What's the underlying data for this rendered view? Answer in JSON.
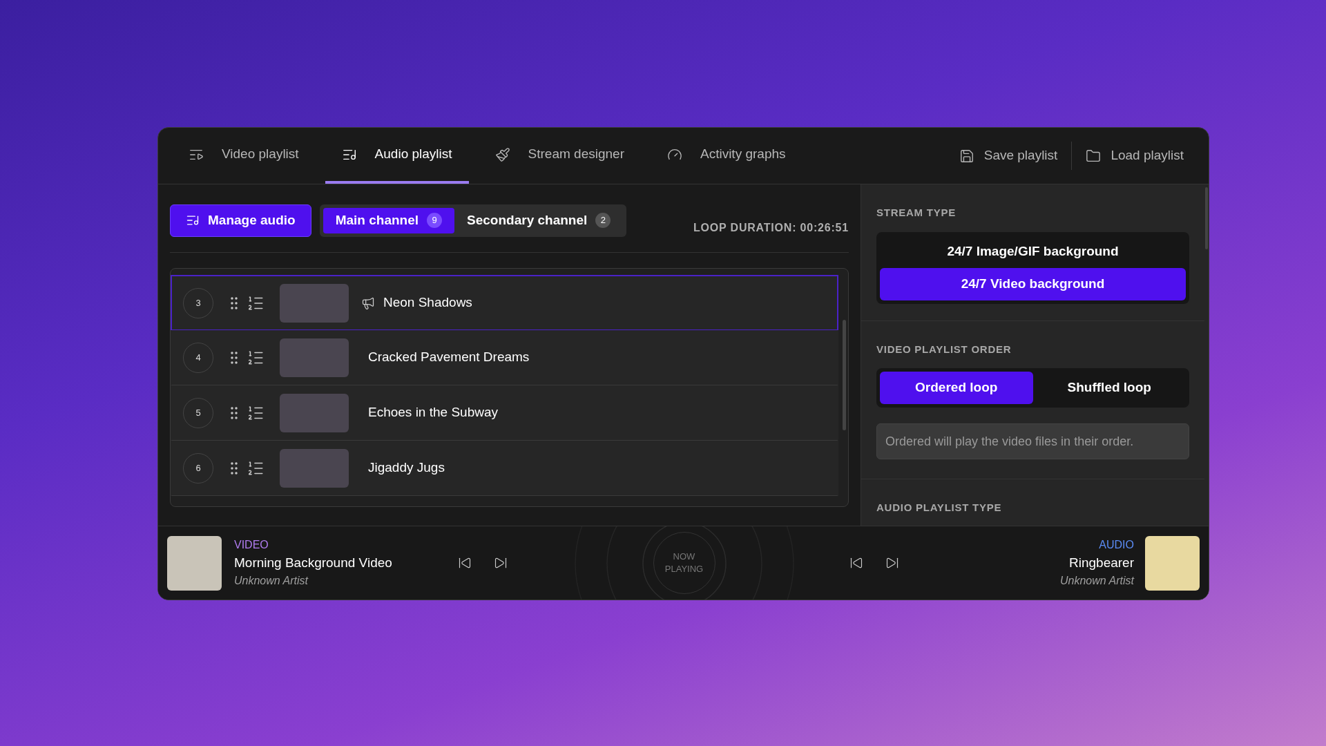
{
  "tabs": [
    {
      "label": "Video playlist",
      "selected": false
    },
    {
      "label": "Audio playlist",
      "selected": true
    },
    {
      "label": "Stream designer",
      "selected": false
    },
    {
      "label": "Activity graphs",
      "selected": false
    }
  ],
  "actions": [
    {
      "label": "Save playlist"
    },
    {
      "label": "Load playlist"
    }
  ],
  "manage_button": "Manage audio",
  "channels": [
    {
      "label": "Main channel",
      "count": "9",
      "selected": true
    },
    {
      "label": "Secondary channel",
      "count": "2",
      "selected": false
    }
  ],
  "loop_duration": "LOOP DURATION: 00:26:51",
  "tracks": [
    {
      "number": "3",
      "title": "Neon Shadows",
      "announce": true,
      "selected": true
    },
    {
      "number": "4",
      "title": "Cracked Pavement Dreams",
      "announce": false,
      "selected": false
    },
    {
      "number": "5",
      "title": "Echoes in the Subway",
      "announce": false,
      "selected": false
    },
    {
      "number": "6",
      "title": "Jigaddy Jugs",
      "announce": false,
      "selected": false
    }
  ],
  "settings": {
    "stream_type": {
      "heading": "STREAM TYPE",
      "options": [
        {
          "label": "24/7 Image/GIF background",
          "selected": false
        },
        {
          "label": "24/7 Video background",
          "selected": true
        }
      ]
    },
    "video_order": {
      "heading": "VIDEO PLAYLIST ORDER",
      "options": [
        {
          "label": "Ordered loop",
          "selected": true
        },
        {
          "label": "Shuffled loop",
          "selected": false
        }
      ],
      "description": "Ordered will play the video files in their order."
    },
    "audio_type": {
      "heading": "AUDIO PLAYLIST TYPE"
    }
  },
  "now_playing": {
    "video": {
      "label": "VIDEO",
      "title": "Morning Background Video",
      "artist": "Unknown Artist"
    },
    "center": "NOW PLAYING",
    "audio": {
      "label": "AUDIO",
      "title": "Ringbearer",
      "artist": "Unknown Artist"
    }
  }
}
